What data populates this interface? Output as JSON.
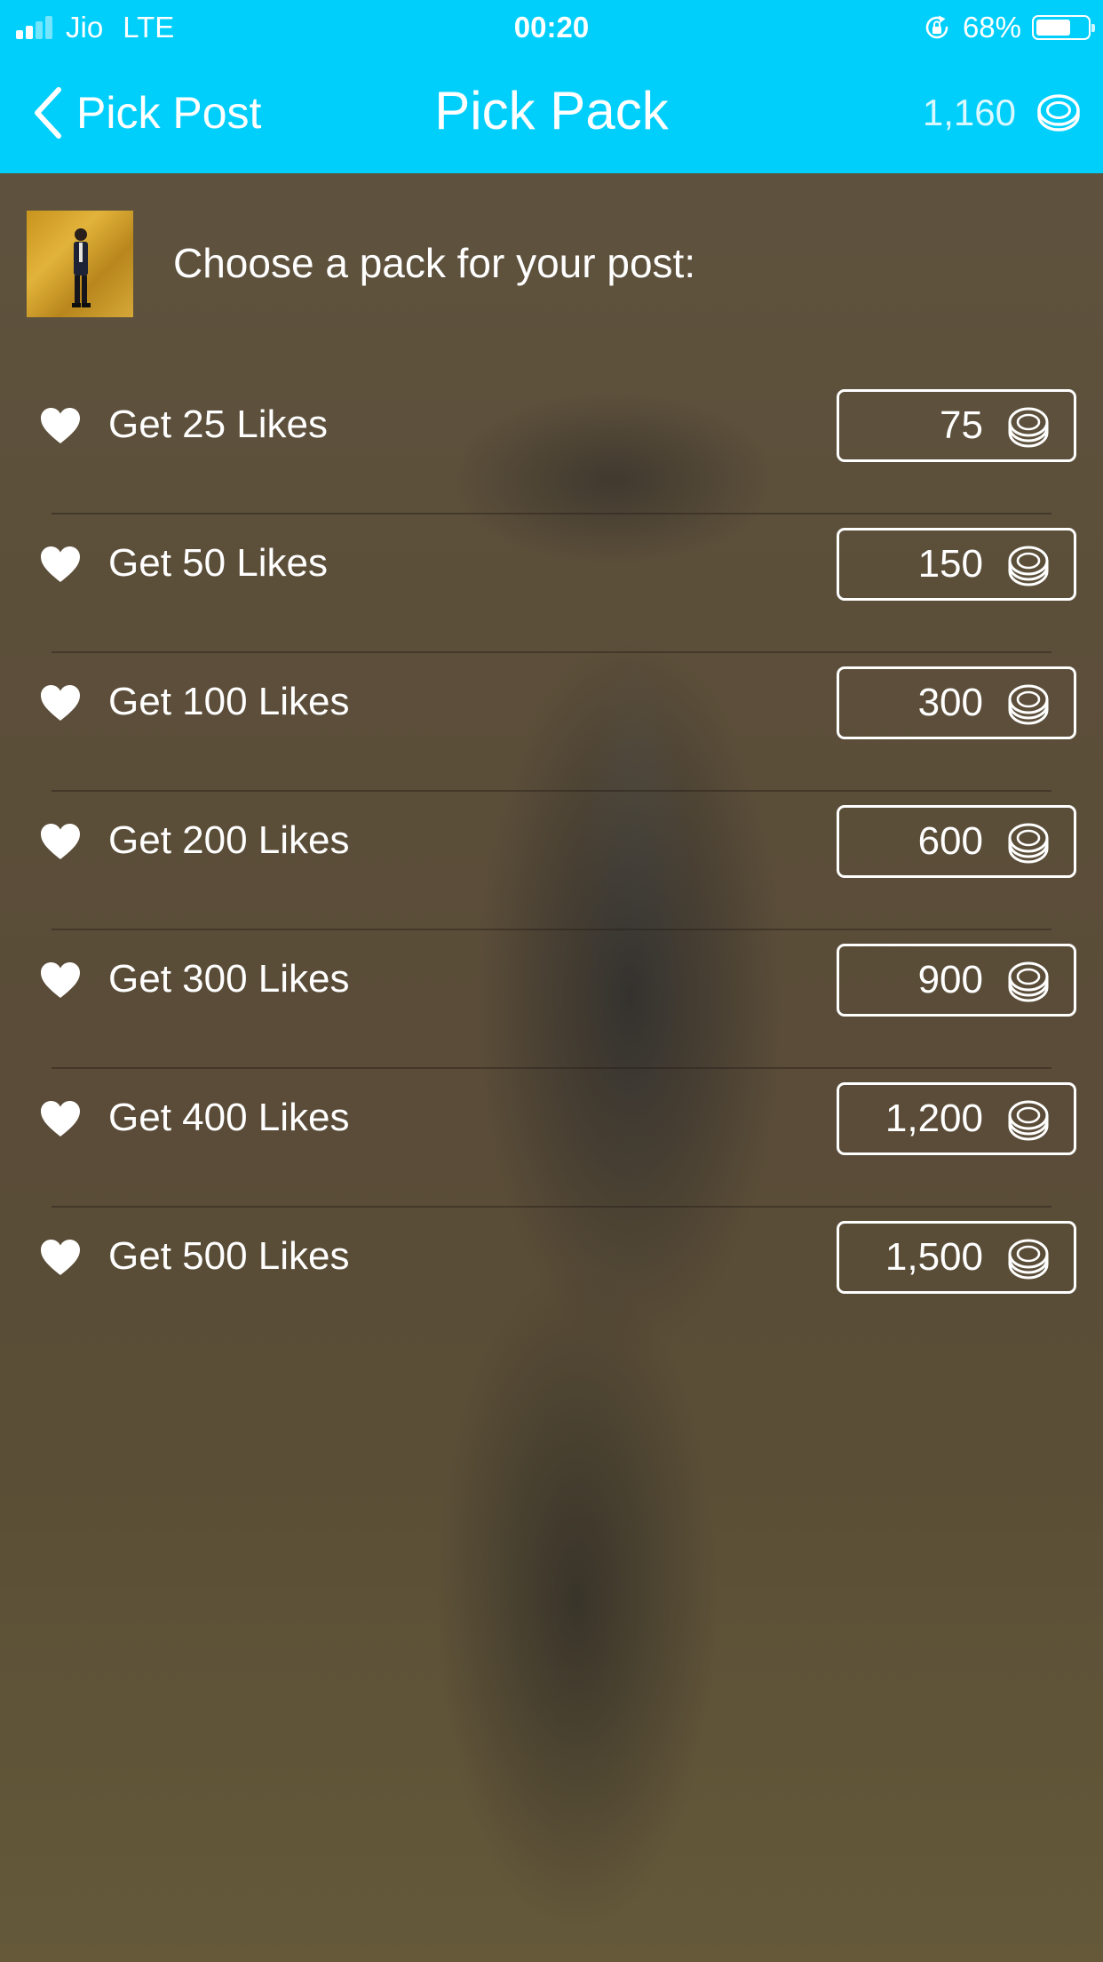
{
  "status_bar": {
    "carrier": "Jio",
    "network": "LTE",
    "time": "00:20",
    "battery_percent_label": "68%",
    "battery_level": 0.68
  },
  "nav": {
    "back_label": "Pick Post",
    "title": "Pick Pack",
    "coin_balance": "1,160",
    "accent_color": "#00cffb"
  },
  "header": {
    "prompt": "Choose a pack for your post:"
  },
  "packs": [
    {
      "label": "Get 25 Likes",
      "price": "75"
    },
    {
      "label": "Get 50 Likes",
      "price": "150"
    },
    {
      "label": "Get 100 Likes",
      "price": "300"
    },
    {
      "label": "Get 200 Likes",
      "price": "600"
    },
    {
      "label": "Get 300 Likes",
      "price": "900"
    },
    {
      "label": "Get 400 Likes",
      "price": "1,200"
    },
    {
      "label": "Get 500 Likes",
      "price": "1,500"
    }
  ],
  "icons": {
    "back": "chevron-left-icon",
    "coin": "coin-stack-icon",
    "heart": "heart-icon",
    "lock_rotation": "rotation-lock-icon",
    "battery": "battery-icon",
    "signal": "signal-bars-icon"
  }
}
